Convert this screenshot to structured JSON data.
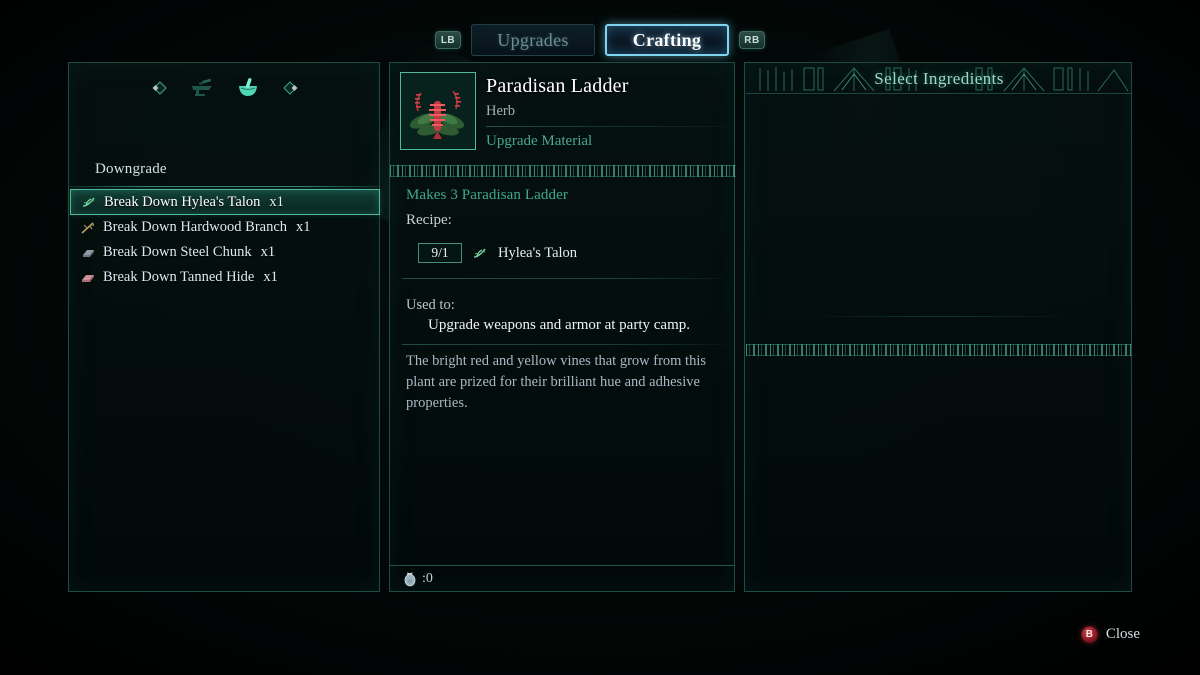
{
  "tabbar": {
    "left_bumper": "LB",
    "right_bumper": "RB",
    "tabs": [
      {
        "label": "Upgrades",
        "active": false
      },
      {
        "label": "Crafting",
        "active": true
      }
    ]
  },
  "left_panel": {
    "categories": [
      {
        "icon": "nav-left-diamond-icon",
        "selected": false
      },
      {
        "icon": "anvil-icon",
        "selected": false
      },
      {
        "icon": "mortar-pestle-icon",
        "selected": true
      },
      {
        "icon": "nav-right-diamond-icon",
        "selected": false
      }
    ],
    "section_label": "Downgrade",
    "items": [
      {
        "icon": "talon-icon",
        "label": "Break Down Hylea's Talon",
        "qty": "x1",
        "selected": true
      },
      {
        "icon": "branch-icon",
        "label": "Break Down Hardwood Branch",
        "qty": "x1",
        "selected": false
      },
      {
        "icon": "steel-icon",
        "label": "Break Down Steel Chunk",
        "qty": "x1",
        "selected": false
      },
      {
        "icon": "hide-icon",
        "label": "Break Down Tanned Hide",
        "qty": "x1",
        "selected": false
      }
    ]
  },
  "detail_panel": {
    "thumbnail_icon": "paradisan-ladder-plant-icon",
    "title": "Paradisan Ladder",
    "item_type": "Herb",
    "category": "Upgrade Material",
    "makes_line": "Makes 3 Paradisan Ladder",
    "recipe_label": "Recipe:",
    "recipe": [
      {
        "quantity": "9/1",
        "icon": "talon-icon",
        "name": "Hylea's Talon"
      }
    ],
    "used_to_label": "Used to:",
    "used_to_text": "Upgrade weapons and armor at party camp.",
    "description": "The bright red and yellow vines that grow from this plant are prized for their brilliant hue and adhesive properties.",
    "currency": {
      "icon": "coin-pouch-icon",
      "value": ":0"
    }
  },
  "right_panel": {
    "title": "Select Ingredients",
    "items": []
  },
  "footer": {
    "button_glyph": "B",
    "button_label": "Close"
  },
  "colors": {
    "accent_teal": "#4fb79a",
    "accent_cyan": "#7fd4ef",
    "text_primary": "#f0f3f7",
    "text_muted": "#9fb2b8",
    "panel_border": "#348070",
    "close_red": "#8d1a22"
  }
}
